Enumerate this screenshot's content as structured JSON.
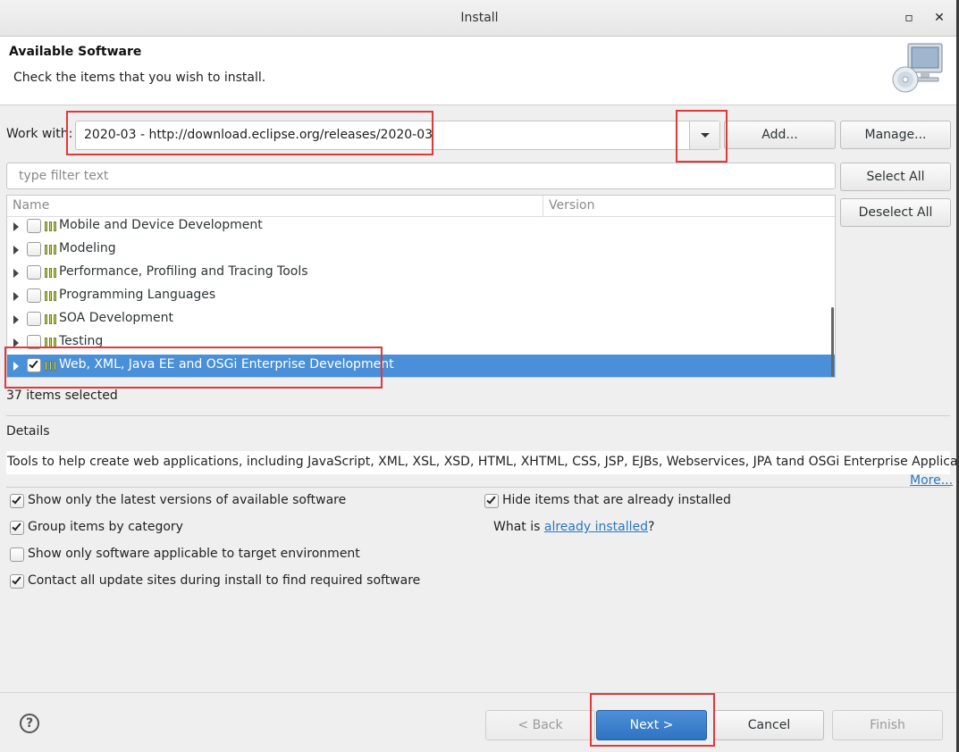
{
  "window": {
    "title": "Install",
    "maximize_glyph": "▫",
    "close_glyph": "✕"
  },
  "header": {
    "title": "Available Software",
    "subtitle": "Check the items that you wish to install.",
    "icon": "computer-cd-icon"
  },
  "work_with": {
    "label": "Work with:",
    "value": "2020-03 - http://download.eclipse.org/releases/2020-03",
    "add_label": "Add...",
    "manage_label": "Manage..."
  },
  "filter": {
    "placeholder": "type filter text",
    "value": ""
  },
  "side_buttons": {
    "select_all": "Select All",
    "deselect_all": "Deselect All"
  },
  "tree": {
    "columns": [
      "Name",
      "Version"
    ],
    "rows": [
      {
        "label": "Mobile and Device Development",
        "checked": false,
        "selected": false
      },
      {
        "label": "Modeling",
        "checked": false,
        "selected": false
      },
      {
        "label": "Performance, Profiling and Tracing Tools",
        "checked": false,
        "selected": false
      },
      {
        "label": "Programming Languages",
        "checked": false,
        "selected": false
      },
      {
        "label": "SOA Development",
        "checked": false,
        "selected": false
      },
      {
        "label": "Testing",
        "checked": false,
        "selected": false
      },
      {
        "label": "Web, XML, Java EE and OSGi Enterprise Development",
        "checked": true,
        "selected": true
      }
    ]
  },
  "status": {
    "selected_count": "37 items selected"
  },
  "details": {
    "label": "Details",
    "text": "Tools to help create web applications, including JavaScript, XML, XSL, XSD, HTML, XHTML, CSS, JSP, EJBs, Webservices, JPA tand OSGi Enterprise Applications",
    "more_link": "More..."
  },
  "options": {
    "latest_versions": {
      "label": "Show only the latest versions of available software",
      "checked": true
    },
    "group_by_category": {
      "label": "Group items by category",
      "checked": true
    },
    "target_env": {
      "label": "Show only software applicable to target environment",
      "checked": false
    },
    "contact_sites": {
      "label": "Contact all update sites during install to find required software",
      "checked": true
    },
    "hide_installed": {
      "label": "Hide items that are already installed",
      "checked": true
    },
    "what_is_prefix": "What is ",
    "what_is_link": "already installed",
    "what_is_suffix": "?"
  },
  "footer": {
    "help_glyph": "?",
    "back_label": "< Back",
    "next_label": "Next >",
    "cancel_label": "Cancel",
    "finish_label": "Finish"
  },
  "colors": {
    "selection": "#4a90d9",
    "highlight": "#e0393b",
    "link": "#2a76c6",
    "primary_button": "#3a7fcc"
  }
}
